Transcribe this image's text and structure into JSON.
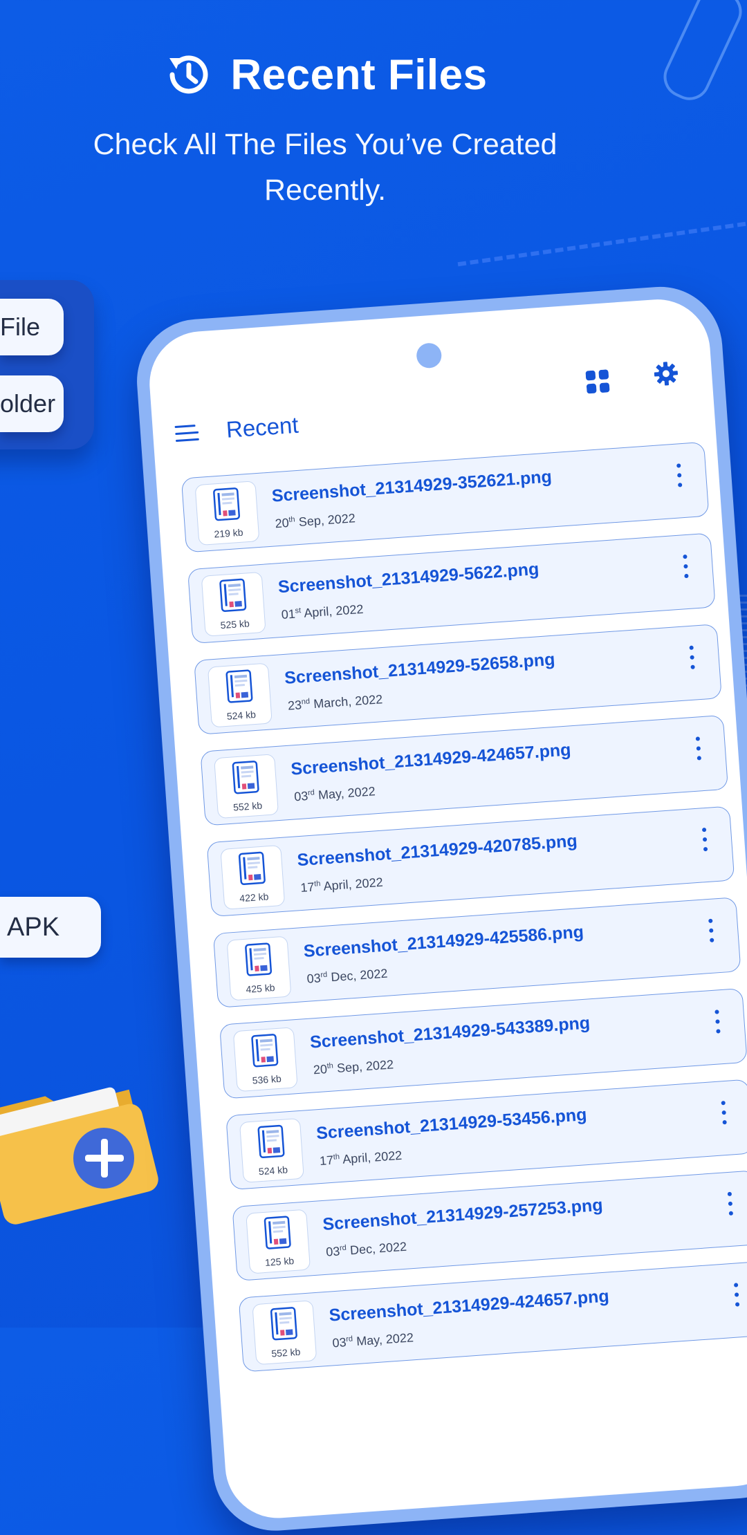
{
  "header": {
    "title": "Recent Files",
    "subtitle": "Check All The Files You’ve Created Recently."
  },
  "side_chips": {
    "file_label": "File",
    "folder_label": "older",
    "apk_label": "APK"
  },
  "app": {
    "title": "Recent",
    "icons": {
      "menu": "hamburger-icon",
      "grid": "grid-view-icon",
      "settings": "gear-icon"
    }
  },
  "files": [
    {
      "name": "Screenshot_21314929-352621.png",
      "day": "20",
      "suffix": "th",
      "rest": " Sep, 2022",
      "size": "219 kb"
    },
    {
      "name": "Screenshot_21314929-5622.png",
      "day": "01",
      "suffix": "st",
      "rest": " April, 2022",
      "size": "525 kb"
    },
    {
      "name": "Screenshot_21314929-52658.png",
      "day": "23",
      "suffix": "nd",
      "rest": " March, 2022",
      "size": "524 kb"
    },
    {
      "name": "Screenshot_21314929-424657.png",
      "day": "03",
      "suffix": "rd",
      "rest": " May, 2022",
      "size": "552 kb"
    },
    {
      "name": "Screenshot_21314929-420785.png",
      "day": "17",
      "suffix": "th",
      "rest": " April, 2022",
      "size": "422 kb"
    },
    {
      "name": "Screenshot_21314929-425586.png",
      "day": "03",
      "suffix": "rd",
      "rest": " Dec, 2022",
      "size": "425 kb"
    },
    {
      "name": "Screenshot_21314929-543389.png",
      "day": "20",
      "suffix": "th",
      "rest": " Sep, 2022",
      "size": "536 kb"
    },
    {
      "name": "Screenshot_21314929-53456.png",
      "day": "17",
      "suffix": "th",
      "rest": " April, 2022",
      "size": "524 kb"
    },
    {
      "name": "Screenshot_21314929-257253.png",
      "day": "03",
      "suffix": "rd",
      "rest": " Dec, 2022",
      "size": "125 kb"
    },
    {
      "name": "Screenshot_21314929-424657.png",
      "day": "03",
      "suffix": "rd",
      "rest": " May, 2022",
      "size": "552 kb"
    }
  ],
  "colors": {
    "background": "#0b57e3",
    "accent": "#1554d6",
    "phone_frame": "#8db4f6",
    "row_bg": "#eef4ff"
  }
}
